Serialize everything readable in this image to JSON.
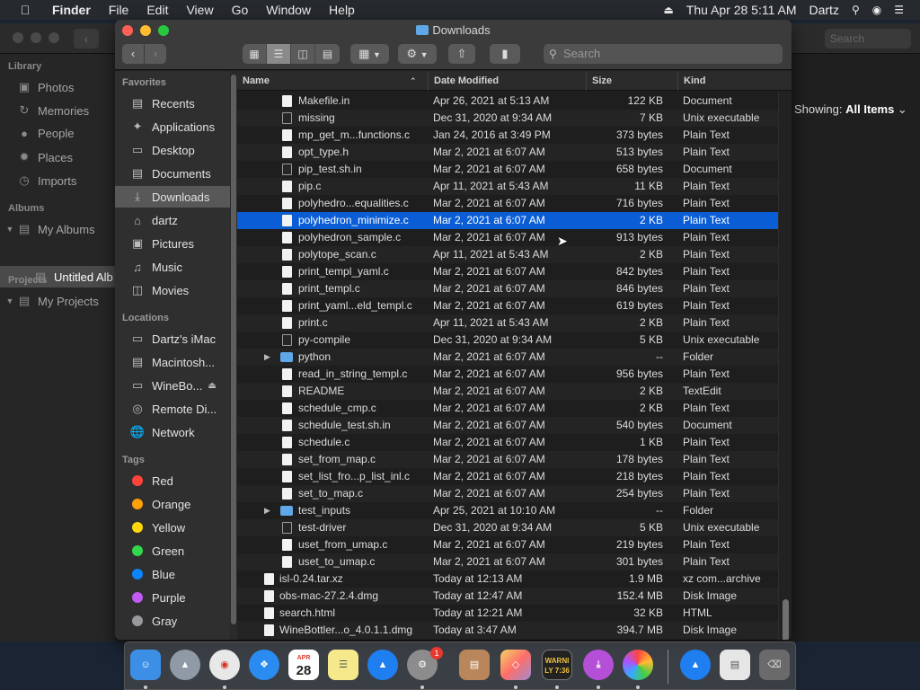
{
  "menubar": {
    "app": "Finder",
    "menus": [
      "File",
      "Edit",
      "View",
      "Go",
      "Window",
      "Help"
    ],
    "datetime": "Thu Apr 28  5:11 AM",
    "user": "Dartz"
  },
  "photos": {
    "sidebar": {
      "library_header": "Library",
      "library_items": [
        "Photos",
        "Memories",
        "People",
        "Places",
        "Imports"
      ],
      "albums_header": "Albums",
      "my_albums": "My Albums",
      "untitled_album": "Untitled Alb",
      "projects_header": "Projects",
      "my_projects": "My Projects"
    },
    "search_placeholder": "Search",
    "showing_label": "Showing:",
    "showing_value": "All Items"
  },
  "finder": {
    "title": "Downloads",
    "search_placeholder": "Search",
    "sidebar": {
      "favorites_header": "Favorites",
      "favorites": [
        "Recents",
        "Applications",
        "Desktop",
        "Documents",
        "Downloads",
        "dartz",
        "Pictures",
        "Music",
        "Movies"
      ],
      "locations_header": "Locations",
      "locations": [
        "Dartz's iMac",
        "Macintosh...",
        "WineBo...",
        "Remote Di...",
        "Network"
      ],
      "tags_header": "Tags",
      "tags": [
        {
          "label": "Red",
          "color": "#ff453a"
        },
        {
          "label": "Orange",
          "color": "#ff9f0a"
        },
        {
          "label": "Yellow",
          "color": "#ffd60a"
        },
        {
          "label": "Green",
          "color": "#32d74b"
        },
        {
          "label": "Blue",
          "color": "#0a84ff"
        },
        {
          "label": "Purple",
          "color": "#bf5af2"
        },
        {
          "label": "Gray",
          "color": "#98989d"
        }
      ]
    },
    "columns": {
      "name": "Name",
      "date": "Date Modified",
      "size": "Size",
      "kind": "Kind"
    },
    "rows": [
      {
        "name": "Makefile.in",
        "date": "Apr 26, 2021 at 5:13 AM",
        "size": "122 KB",
        "kind": "Document",
        "icon": "doc"
      },
      {
        "name": "missing",
        "date": "Dec 31, 2020 at 9:34 AM",
        "size": "7 KB",
        "kind": "Unix executable",
        "icon": "exec"
      },
      {
        "name": "mp_get_m...functions.c",
        "date": "Jan 24, 2016 at 3:49 PM",
        "size": "373 bytes",
        "kind": "Plain Text",
        "icon": "doc"
      },
      {
        "name": "opt_type.h",
        "date": "Mar 2, 2021 at 6:07 AM",
        "size": "513 bytes",
        "kind": "Plain Text",
        "icon": "doc"
      },
      {
        "name": "pip_test.sh.in",
        "date": "Mar 2, 2021 at 6:07 AM",
        "size": "658 bytes",
        "kind": "Document",
        "icon": "exec"
      },
      {
        "name": "pip.c",
        "date": "Apr 11, 2021 at 5:43 AM",
        "size": "11 KB",
        "kind": "Plain Text",
        "icon": "doc"
      },
      {
        "name": "polyhedro...equalities.c",
        "date": "Mar 2, 2021 at 6:07 AM",
        "size": "716 bytes",
        "kind": "Plain Text",
        "icon": "doc"
      },
      {
        "name": "polyhedron_minimize.c",
        "date": "Mar 2, 2021 at 6:07 AM",
        "size": "2 KB",
        "kind": "Plain Text",
        "icon": "doc"
      },
      {
        "name": "polyhedron_sample.c",
        "date": "Mar 2, 2021 at 6:07 AM",
        "size": "913 bytes",
        "kind": "Plain Text",
        "icon": "doc"
      },
      {
        "name": "polytope_scan.c",
        "date": "Apr 11, 2021 at 5:43 AM",
        "size": "2 KB",
        "kind": "Plain Text",
        "icon": "doc"
      },
      {
        "name": "print_templ_yaml.c",
        "date": "Mar 2, 2021 at 6:07 AM",
        "size": "842 bytes",
        "kind": "Plain Text",
        "icon": "doc"
      },
      {
        "name": "print_templ.c",
        "date": "Mar 2, 2021 at 6:07 AM",
        "size": "846 bytes",
        "kind": "Plain Text",
        "icon": "doc"
      },
      {
        "name": "print_yaml...eld_templ.c",
        "date": "Mar 2, 2021 at 6:07 AM",
        "size": "619 bytes",
        "kind": "Plain Text",
        "icon": "doc"
      },
      {
        "name": "print.c",
        "date": "Apr 11, 2021 at 5:43 AM",
        "size": "2 KB",
        "kind": "Plain Text",
        "icon": "doc"
      },
      {
        "name": "py-compile",
        "date": "Dec 31, 2020 at 9:34 AM",
        "size": "5 KB",
        "kind": "Unix executable",
        "icon": "exec"
      },
      {
        "name": "python",
        "date": "Mar 2, 2021 at 6:07 AM",
        "size": "--",
        "kind": "Folder",
        "icon": "folder"
      },
      {
        "name": "read_in_string_templ.c",
        "date": "Mar 2, 2021 at 6:07 AM",
        "size": "956 bytes",
        "kind": "Plain Text",
        "icon": "doc"
      },
      {
        "name": "README",
        "date": "Mar 2, 2021 at 6:07 AM",
        "size": "2 KB",
        "kind": "TextEdit",
        "icon": "doc"
      },
      {
        "name": "schedule_cmp.c",
        "date": "Mar 2, 2021 at 6:07 AM",
        "size": "2 KB",
        "kind": "Plain Text",
        "icon": "doc"
      },
      {
        "name": "schedule_test.sh.in",
        "date": "Mar 2, 2021 at 6:07 AM",
        "size": "540 bytes",
        "kind": "Document",
        "icon": "doc"
      },
      {
        "name": "schedule.c",
        "date": "Mar 2, 2021 at 6:07 AM",
        "size": "1 KB",
        "kind": "Plain Text",
        "icon": "doc"
      },
      {
        "name": "set_from_map.c",
        "date": "Mar 2, 2021 at 6:07 AM",
        "size": "178 bytes",
        "kind": "Plain Text",
        "icon": "doc"
      },
      {
        "name": "set_list_fro...p_list_inl.c",
        "date": "Mar 2, 2021 at 6:07 AM",
        "size": "218 bytes",
        "kind": "Plain Text",
        "icon": "doc"
      },
      {
        "name": "set_to_map.c",
        "date": "Mar 2, 2021 at 6:07 AM",
        "size": "254 bytes",
        "kind": "Plain Text",
        "icon": "doc"
      },
      {
        "name": "test_inputs",
        "date": "Apr 25, 2021 at 10:10 AM",
        "size": "--",
        "kind": "Folder",
        "icon": "folder"
      },
      {
        "name": "test-driver",
        "date": "Dec 31, 2020 at 9:34 AM",
        "size": "5 KB",
        "kind": "Unix executable",
        "icon": "exec"
      },
      {
        "name": "uset_from_umap.c",
        "date": "Mar 2, 2021 at 6:07 AM",
        "size": "219 bytes",
        "kind": "Plain Text",
        "icon": "doc"
      },
      {
        "name": "uset_to_umap.c",
        "date": "Mar 2, 2021 at 6:07 AM",
        "size": "301 bytes",
        "kind": "Plain Text",
        "icon": "doc"
      },
      {
        "name": "isl-0.24.tar.xz",
        "date": "Today at 12:13 AM",
        "size": "1.9 MB",
        "kind": "xz com...archive",
        "icon": "doc",
        "top": true
      },
      {
        "name": "obs-mac-27.2.4.dmg",
        "date": "Today at 12:47 AM",
        "size": "152.4 MB",
        "kind": "Disk Image",
        "icon": "doc",
        "top": true
      },
      {
        "name": "search.html",
        "date": "Today at 12:21 AM",
        "size": "32 KB",
        "kind": "HTML",
        "icon": "doc",
        "top": true
      },
      {
        "name": "WineBottler...o_4.0.1.1.dmg",
        "date": "Today at 3:47 AM",
        "size": "394.7 MB",
        "kind": "Disk Image",
        "icon": "doc",
        "top": true
      }
    ],
    "selected_row": 7
  },
  "dock": {
    "calendar_month": "APR",
    "calendar_day": "28",
    "console_text": "WARNI\nLY 7:36",
    "badge_count": "1"
  }
}
